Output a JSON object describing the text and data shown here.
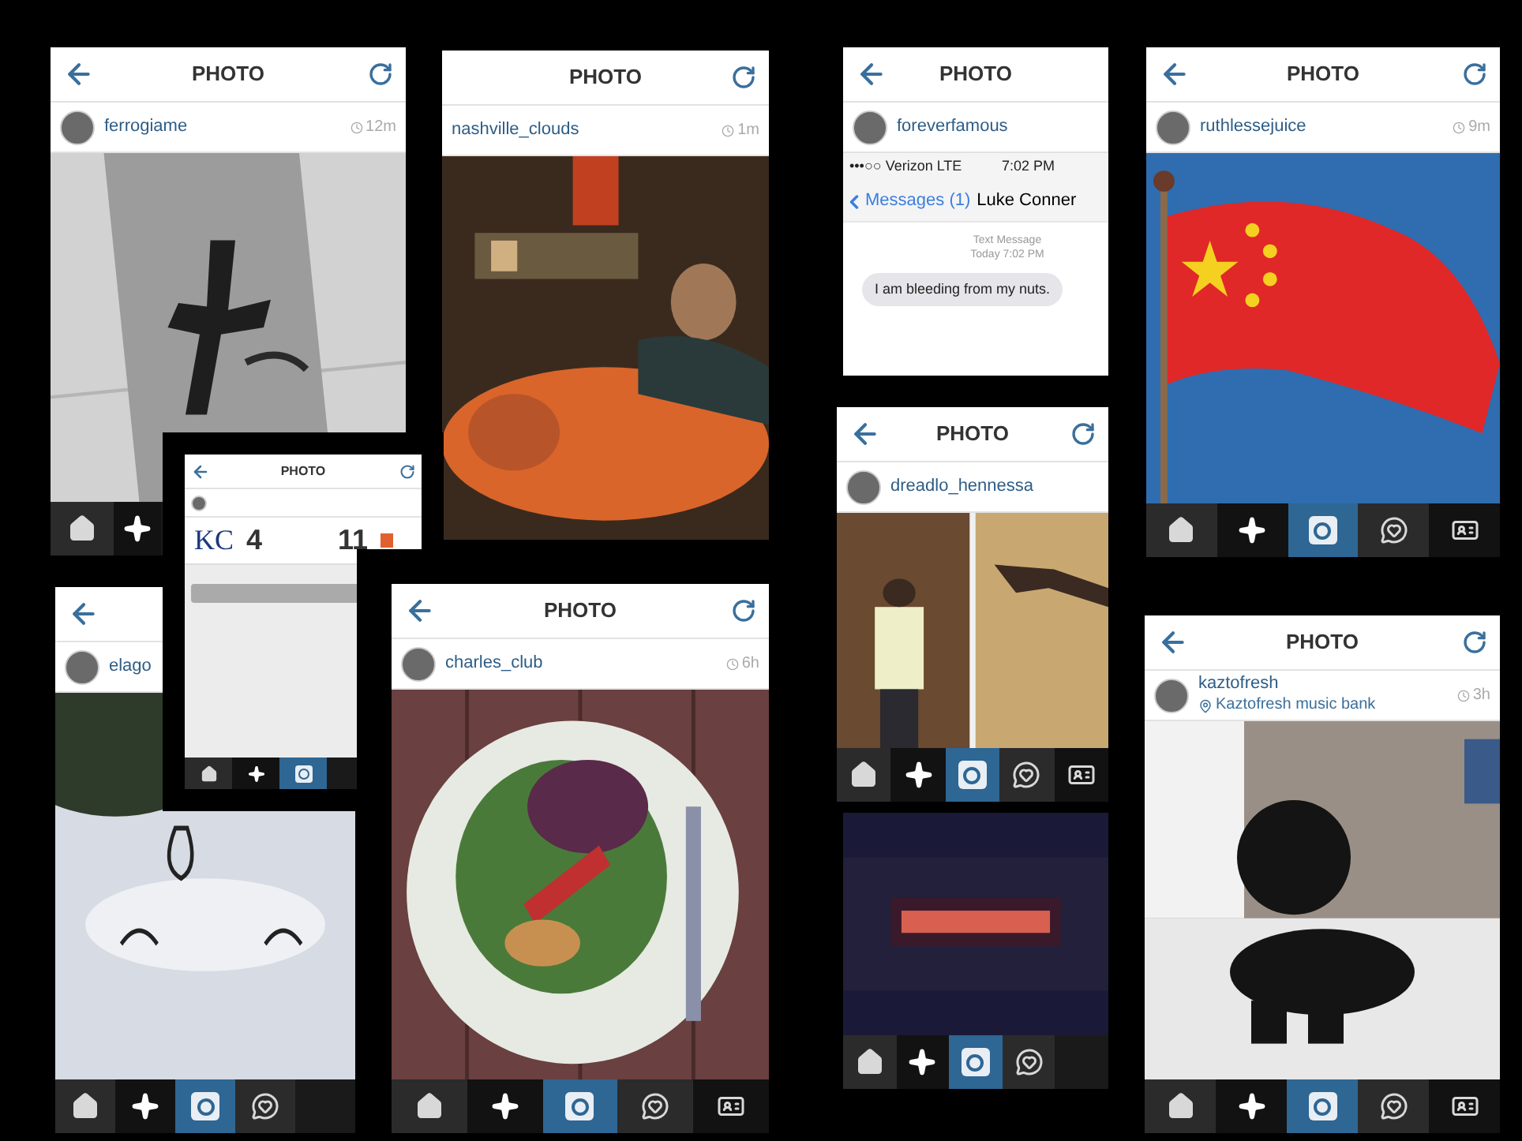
{
  "screens": [
    {
      "title": "PHOTO",
      "back": true,
      "refresh": true,
      "user": {
        "name": "ferrogiame",
        "time": "12m",
        "avatar": true
      },
      "photo": {
        "kind": "picture"
      },
      "nav": [
        {
          "kind": "home",
          "selected": false
        },
        {
          "kind": "explore",
          "selected": false
        }
      ]
    },
    {
      "title": "PHOTO",
      "back": false,
      "refresh": true,
      "user": {
        "name": "nashville_clouds",
        "time": "1m",
        "avatar": false
      },
      "photo": {
        "kind": "picture"
      }
    },
    {
      "title": "PHOTO",
      "back": true,
      "refresh": false,
      "user": {
        "name": "foreverfamous",
        "avatar": true
      },
      "message": {
        "carrier": "•••○○ Verizon LTE",
        "clock": "7:02 PM",
        "back_label": "Messages (1)",
        "contact": "Luke Conner",
        "stamp_1": "Text Message",
        "stamp_2": "Today 7:02 PM",
        "bubble": "I am bleeding from my nuts."
      }
    },
    {
      "title": "PHOTO",
      "back": true,
      "refresh": true,
      "user": {
        "name": "ruthlessejuice",
        "time": "9m",
        "avatar": true
      },
      "photo": {
        "kind": "picture"
      },
      "nav": [
        {
          "kind": "home",
          "selected": false
        },
        {
          "kind": "explore",
          "selected": false
        },
        {
          "kind": "camera",
          "selected": true
        },
        {
          "kind": "heart",
          "selected": false
        },
        {
          "kind": "profile",
          "selected": false
        }
      ]
    },
    {
      "title": "PHOTO",
      "back": true,
      "refresh": true,
      "user": {
        "avatar": true
      },
      "score": {
        "team": "KC",
        "score": "4",
        "opponent_score": "11"
      },
      "nav": [
        {
          "kind": "home",
          "selected": false
        },
        {
          "kind": "explore",
          "selected": false
        },
        {
          "kind": "camera",
          "selected": true
        }
      ]
    },
    {
      "back": true,
      "user": {
        "name": "elago",
        "avatar": true
      },
      "photo": {
        "kind": "picture"
      },
      "nav": [
        {
          "kind": "home",
          "selected": false
        },
        {
          "kind": "explore",
          "selected": false
        },
        {
          "kind": "camera",
          "selected": true
        },
        {
          "kind": "heart",
          "selected": false
        }
      ]
    },
    {
      "title": "PHOTO",
      "back": true,
      "refresh": true,
      "user": {
        "name": "charles_club",
        "time": "6h",
        "avatar": true
      },
      "photo": {
        "kind": "picture"
      },
      "nav": [
        {
          "kind": "home",
          "selected": false
        },
        {
          "kind": "explore",
          "selected": false
        },
        {
          "kind": "camera",
          "selected": true
        },
        {
          "kind": "heart",
          "selected": false
        },
        {
          "kind": "profile",
          "selected": false
        }
      ]
    },
    {
      "title": "PHOTO",
      "back": true,
      "refresh": true,
      "user": {
        "name": "dreadlo_hennessa",
        "avatar": true
      },
      "photo": {
        "kind": "picture"
      },
      "nav": [
        {
          "kind": "home",
          "selected": false
        },
        {
          "kind": "explore",
          "selected": false
        },
        {
          "kind": "camera",
          "selected": true
        },
        {
          "kind": "heart",
          "selected": false
        },
        {
          "kind": "profile",
          "selected": false
        }
      ]
    },
    {
      "photo": {
        "kind": "picture"
      },
      "nav": [
        {
          "kind": "home",
          "selected": false
        },
        {
          "kind": "explore",
          "selected": false
        },
        {
          "kind": "camera",
          "selected": true
        },
        {
          "kind": "heart",
          "selected": false
        }
      ]
    },
    {
      "title": "PHOTO",
      "back": true,
      "refresh": true,
      "user": {
        "name": "kaztofresh",
        "location": "Kaztofresh music bank",
        "time": "3h",
        "avatar": true
      },
      "photo": {
        "kind": "picture"
      },
      "nav": [
        {
          "kind": "home",
          "selected": false
        },
        {
          "kind": "explore",
          "selected": false
        },
        {
          "kind": "camera",
          "selected": true
        },
        {
          "kind": "heart",
          "selected": false
        },
        {
          "kind": "profile",
          "selected": false
        }
      ]
    }
  ]
}
